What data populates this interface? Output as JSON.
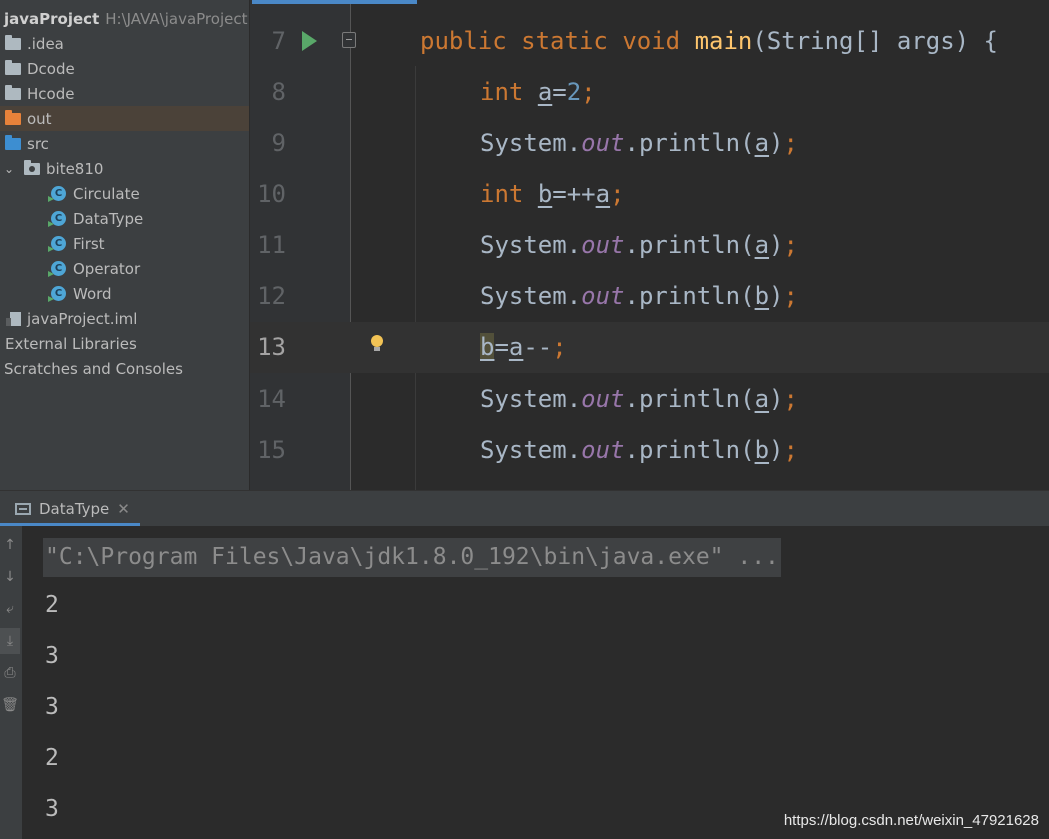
{
  "project": {
    "name": "javaProject",
    "path": "H:\\JAVA\\javaProject",
    "items": [
      {
        "label": ".idea",
        "kind": "folder",
        "icon": "folder-icon"
      },
      {
        "label": "Dcode",
        "kind": "folder",
        "icon": "folder-icon"
      },
      {
        "label": "Hcode",
        "kind": "folder",
        "icon": "folder-icon"
      },
      {
        "label": "out",
        "kind": "folder",
        "icon": "excluded-folder-icon"
      },
      {
        "label": "src",
        "kind": "folder",
        "icon": "source-folder-icon"
      },
      {
        "label": "bite810",
        "kind": "package",
        "icon": "package-icon"
      },
      {
        "label": "Circulate",
        "kind": "class",
        "icon": "java-class-icon"
      },
      {
        "label": "DataType",
        "kind": "class",
        "icon": "java-class-icon"
      },
      {
        "label": "First",
        "kind": "class",
        "icon": "java-class-icon"
      },
      {
        "label": "Operator",
        "kind": "class",
        "icon": "java-class-icon"
      },
      {
        "label": "Word",
        "kind": "class",
        "icon": "java-class-icon"
      },
      {
        "label": "javaProject.iml",
        "kind": "file",
        "icon": "module-file-icon"
      },
      {
        "label": "External Libraries",
        "kind": "node",
        "icon": ""
      },
      {
        "label": "Scratches and Consoles",
        "kind": "node",
        "icon": ""
      }
    ]
  },
  "editor": {
    "current_line": "13",
    "lines": [
      {
        "num": "7"
      },
      {
        "num": "8"
      },
      {
        "num": "9"
      },
      {
        "num": "10"
      },
      {
        "num": "11"
      },
      {
        "num": "12"
      },
      {
        "num": "13"
      },
      {
        "num": "14"
      },
      {
        "num": "15"
      }
    ],
    "tokens": {
      "public": "public",
      "static": "static",
      "void": "void",
      "main": "main",
      "sig": "(String[] args) {",
      "int": "int",
      "a": "a",
      "b": "b",
      "eq": "=",
      "two": "2",
      "semi": ";",
      "system": "System",
      "dot": ".",
      "out": "out",
      "println": "println",
      "lp": "(",
      "rp": ")",
      "preinc": "++",
      "postdec": "--"
    }
  },
  "run": {
    "tab_label": "DataType",
    "command": "\"C:\\Program Files\\Java\\jdk1.8.0_192\\bin\\java.exe\" ...",
    "output": [
      "2",
      "3",
      "3",
      "2",
      "3"
    ]
  },
  "watermark": "https://blog.csdn.net/weixin_47921628",
  "colors": {
    "keyword": "#cc7832",
    "method": "#ffc66d",
    "number": "#6897bb",
    "field": "#9876aa",
    "accent": "#4a88c7"
  }
}
